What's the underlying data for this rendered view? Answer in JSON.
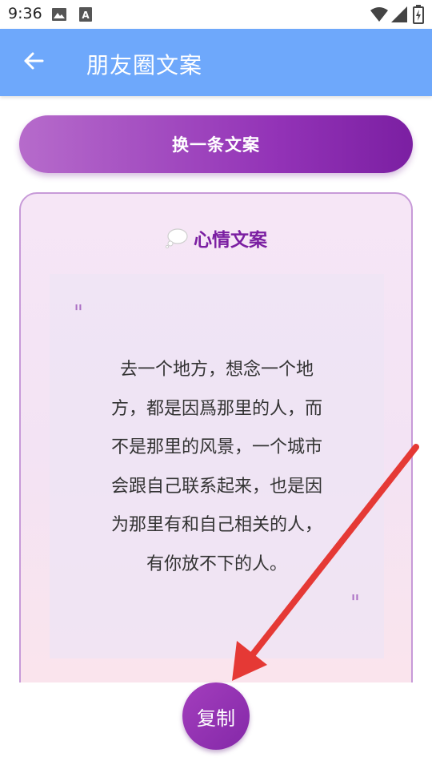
{
  "status_bar": {
    "time": "9:36",
    "icons": [
      "image-icon",
      "font-download-icon",
      "wifi-icon",
      "signal-icon",
      "battery-icon"
    ]
  },
  "app_bar": {
    "title": "朋友圈文案",
    "back_icon": "arrow-left-icon",
    "color": "#6ea8fb"
  },
  "change_button": {
    "label": "换一条文案"
  },
  "card": {
    "icon": "thought-bubble-icon",
    "title": "心情文案",
    "quote_open": "\"",
    "quote_close": "\"",
    "lines": [
      "去一个地方，想念一个地",
      "方，都是因爲那里的人，而",
      "不是那里的风景，一个城市",
      "会跟自己联系起来，也是因",
      "为那里有和自己相关的人，",
      "有你放不下的人。"
    ]
  },
  "copy_button": {
    "label": "复制"
  },
  "colors": {
    "accent": "#7b1fa2",
    "annotation_arrow": "#e53935"
  }
}
